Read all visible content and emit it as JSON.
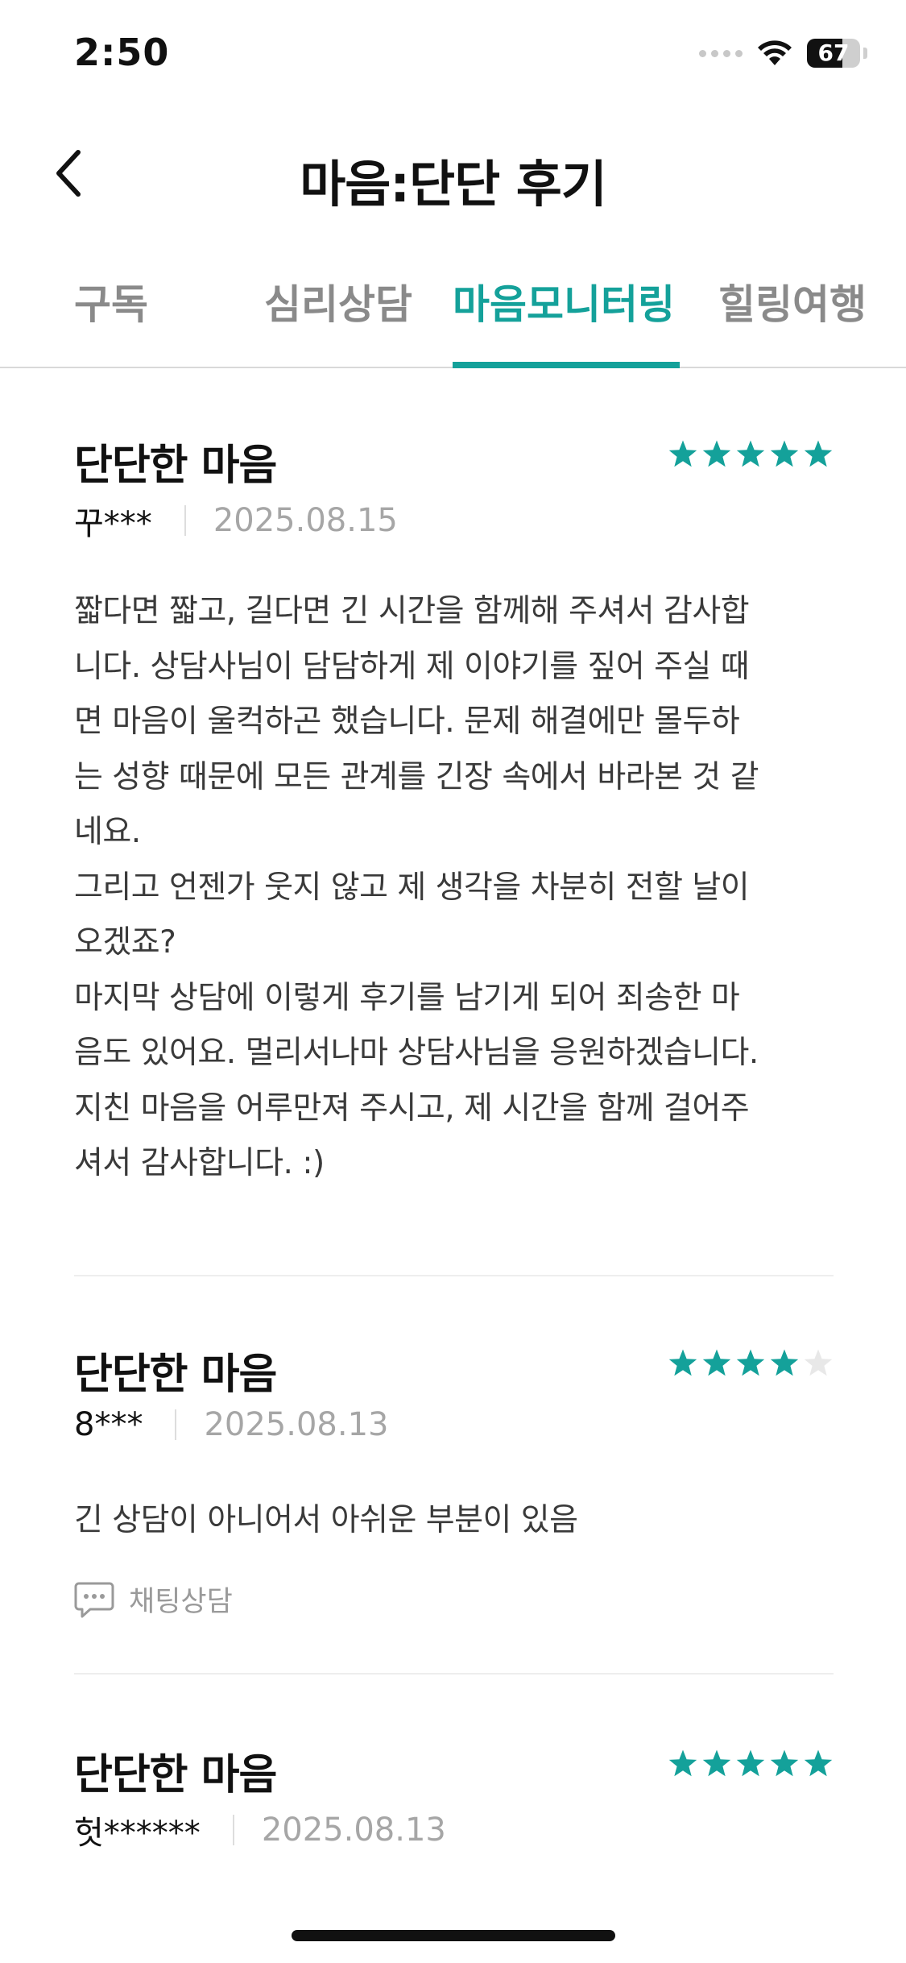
{
  "status_bar": {
    "time": "2:50",
    "battery": "67",
    "battery_level": 0.67
  },
  "header": {
    "back_icon": "chevron-left-icon",
    "title": "마음:단단 후기"
  },
  "tabs": [
    {
      "label": "구독",
      "active": false
    },
    {
      "label": "심리상담",
      "active": false
    },
    {
      "label": "마음모니터링",
      "active": true
    },
    {
      "label": "힐링여행",
      "active": false
    }
  ],
  "colors": {
    "accent": "#14a19a",
    "star_filled": "#14a19a",
    "star_empty": "#e8e8e8"
  },
  "reviews": [
    {
      "title": "단단한 마음",
      "rating": 5,
      "author": "꾸***",
      "date": "2025.08.15",
      "body": "짧다면 짧고, 길다면 긴 시간을 함께해 주셔서 감사합\n니다. 상담사님이 담담하게 제 이야기를 짚어 주실 때\n면 마음이 울컥하곤 했습니다. 문제 해결에만 몰두하\n는 성향 때문에 모든 관계를 긴장 속에서 바라본 것 같\n네요.\n그리고 언젠가 웃지 않고 제 생각을 차분히 전할 날이\n오겠죠?\n마지막 상담에 이렇게 후기를 남기게 되어 죄송한 마\n음도 있어요. 멀리서나마 상담사님을 응원하겠습니다.\n지친 마음을 어루만져 주시고, 제 시간을 함께 걸어주\n셔서 감사합니다. :)"
    },
    {
      "title": "단단한 마음",
      "rating": 4,
      "author": "8***",
      "date": "2025.08.13",
      "body": "긴 상담이 아니어서 아쉬운 부분이 있음",
      "type_icon": "chat-bubble-icon",
      "type_label": "채팅상담"
    },
    {
      "title": "단단한 마음",
      "rating": 5,
      "author": "헛******",
      "date": "2025.08.13"
    }
  ]
}
